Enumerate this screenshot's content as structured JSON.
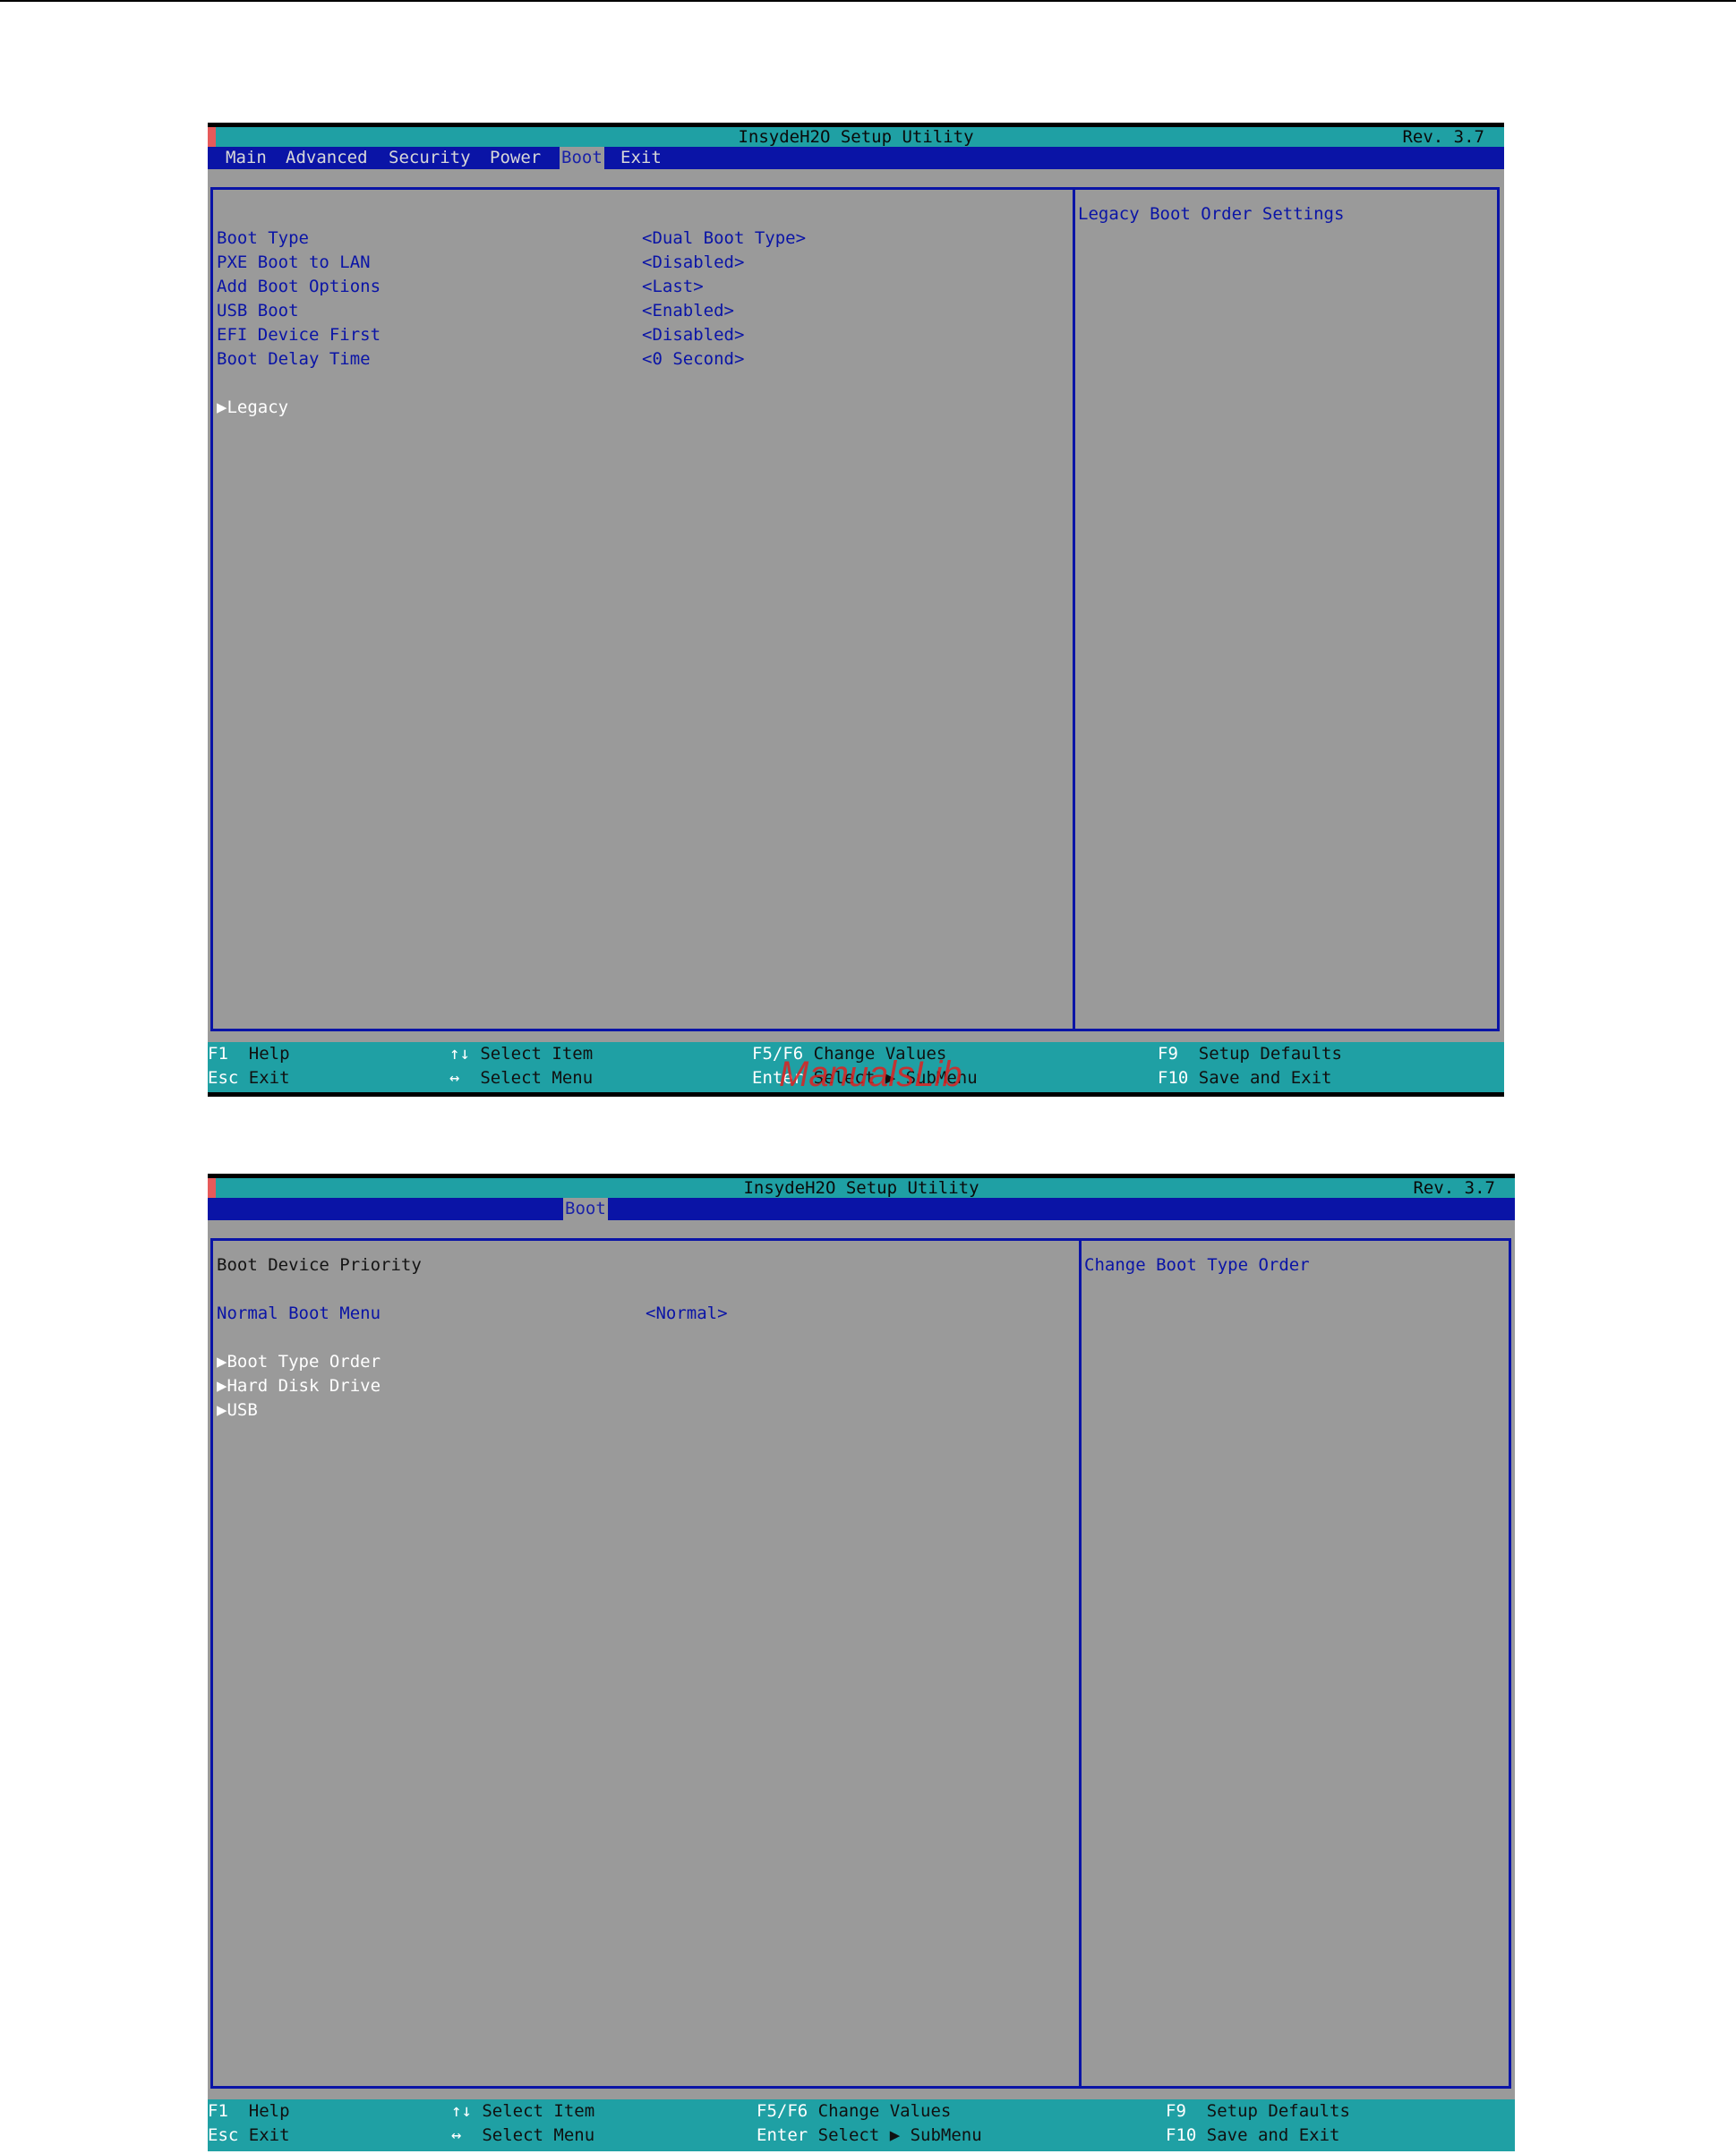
{
  "screens": [
    {
      "title": "InsydeH2O Setup Utility",
      "rev": "Rev. 3.7",
      "tabs": [
        "Main",
        "Advanced",
        "Security",
        "Power",
        "Boot",
        "Exit"
      ],
      "selected_tab": "Boot",
      "header": "",
      "items": [
        {
          "label": "Boot Type",
          "value": "<Dual Boot Type>"
        },
        {
          "label": "PXE Boot to LAN",
          "value": "<Disabled>"
        },
        {
          "label": "Add Boot Options",
          "value": "<Last>"
        },
        {
          "label": "USB Boot",
          "value": "<Enabled>"
        },
        {
          "label": "EFI Device First",
          "value": "<Disabled>"
        },
        {
          "label": "Boot Delay Time",
          "value": "<0 Second>"
        }
      ],
      "submenus": [
        "▶Legacy"
      ],
      "help_text": "Legacy Boot Order Settings",
      "footer": {
        "f1_key": "F1",
        "f1_desc": "Help",
        "esc_key": "Esc",
        "esc_desc": "Exit",
        "updown_key": "↑↓",
        "updown_desc": "Select Item",
        "leftright_key": "↔",
        "leftright_desc": "Select Menu",
        "f5f6_key": "F5/F6",
        "f5f6_desc": "Change Values",
        "enter_key": "Enter",
        "enter_desc": "Select ▶ SubMenu",
        "f9_key": "F9",
        "f9_desc": "Setup Defaults",
        "f10_key": "F10",
        "f10_desc": "Save and Exit"
      }
    },
    {
      "title": "InsydeH2O Setup Utility",
      "rev": "Rev. 3.7",
      "tabs": [
        "Boot"
      ],
      "selected_tab": "Boot",
      "header": "Boot Device Priority",
      "items": [
        {
          "label": "Normal Boot Menu",
          "value": "<Normal>"
        }
      ],
      "submenus": [
        "▶Boot Type Order",
        "▶Hard Disk Drive",
        "▶USB"
      ],
      "help_text": "Change Boot Type Order",
      "footer": {
        "f1_key": "F1",
        "f1_desc": "Help",
        "esc_key": "Esc",
        "esc_desc": "Exit",
        "updown_key": "↑↓",
        "updown_desc": "Select Item",
        "leftright_key": "↔",
        "leftright_desc": "Select Menu",
        "f5f6_key": "F5/F6",
        "f5f6_desc": "Change Values",
        "enter_key": "Enter",
        "enter_desc": "Select ▶ SubMenu",
        "f9_key": "F9",
        "f9_desc": "Setup Defaults",
        "f10_key": "F10",
        "f10_desc": "Save and Exit"
      }
    }
  ],
  "watermark": "ManualsLib"
}
